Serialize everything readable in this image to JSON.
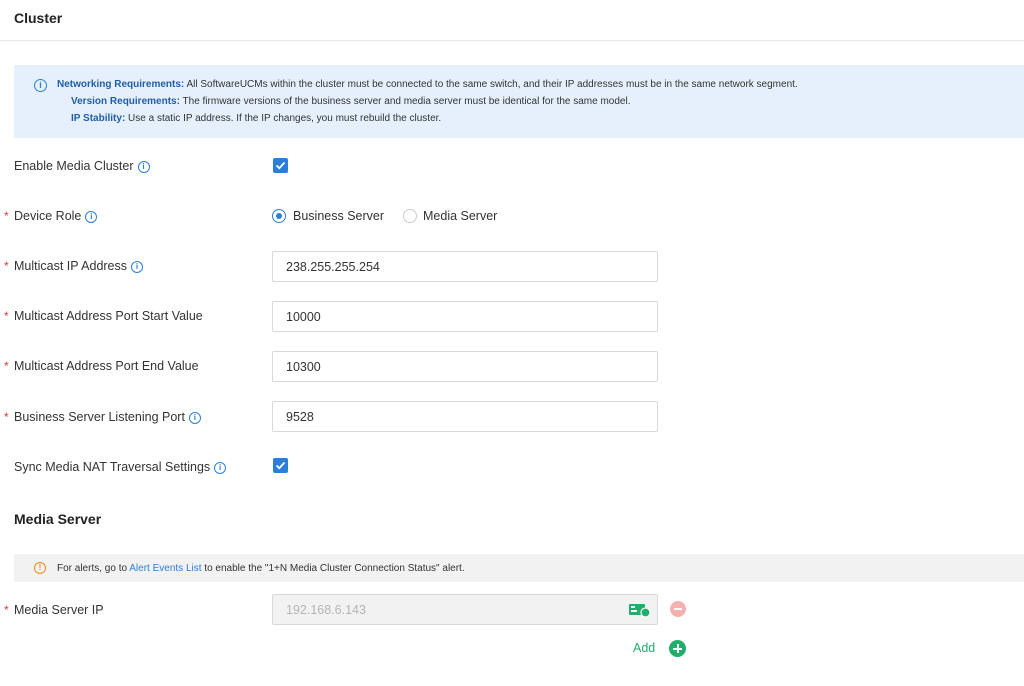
{
  "header": {
    "title": "Cluster"
  },
  "info": {
    "lines": [
      {
        "label": "Networking Requirements:",
        "text": " All SoftwareUCMs within the cluster must be connected to the same switch, and their IP addresses must be in the same network segment."
      },
      {
        "label": "Version Requirements:",
        "text": " The firmware versions of the business server and media server must be identical for the same model."
      },
      {
        "label": "IP Stability:",
        "text": " Use a static IP address. If the IP changes, you must rebuild the cluster."
      }
    ]
  },
  "form": {
    "enable_media_cluster": {
      "label": "Enable Media Cluster",
      "checked": true
    },
    "device_role": {
      "label": "Device Role",
      "options": [
        "Business Server",
        "Media Server"
      ],
      "selected": "Business Server"
    },
    "multicast_ip": {
      "label": "Multicast IP Address",
      "value": "238.255.255.254"
    },
    "port_start": {
      "label": "Multicast Address Port Start Value",
      "value": "10000"
    },
    "port_end": {
      "label": "Multicast Address Port End Value",
      "value": "10300"
    },
    "listening_port": {
      "label": "Business Server Listening Port",
      "value": "9528"
    },
    "sync_nat": {
      "label": "Sync Media NAT Traversal Settings",
      "checked": true
    }
  },
  "media_server": {
    "title": "Media Server",
    "alert": {
      "prefix": "For alerts, go to ",
      "link": "Alert Events List",
      "suffix": " to enable the \"1+N Media Cluster Connection Status\" alert."
    },
    "ip_label": "Media Server IP",
    "ip_value": "192.168.6.143",
    "add_label": "Add"
  },
  "colors": {
    "accent": "#2b7fd9",
    "success": "#1fae6b",
    "danger": "#e23a3a",
    "warning": "#f08c1a"
  },
  "icons": {
    "info": "info-circle-icon",
    "help": "help-circle-icon",
    "warning": "warning-circle-icon",
    "nat": "network-card-icon",
    "remove": "minus-circle-icon",
    "add": "plus-circle-icon"
  }
}
